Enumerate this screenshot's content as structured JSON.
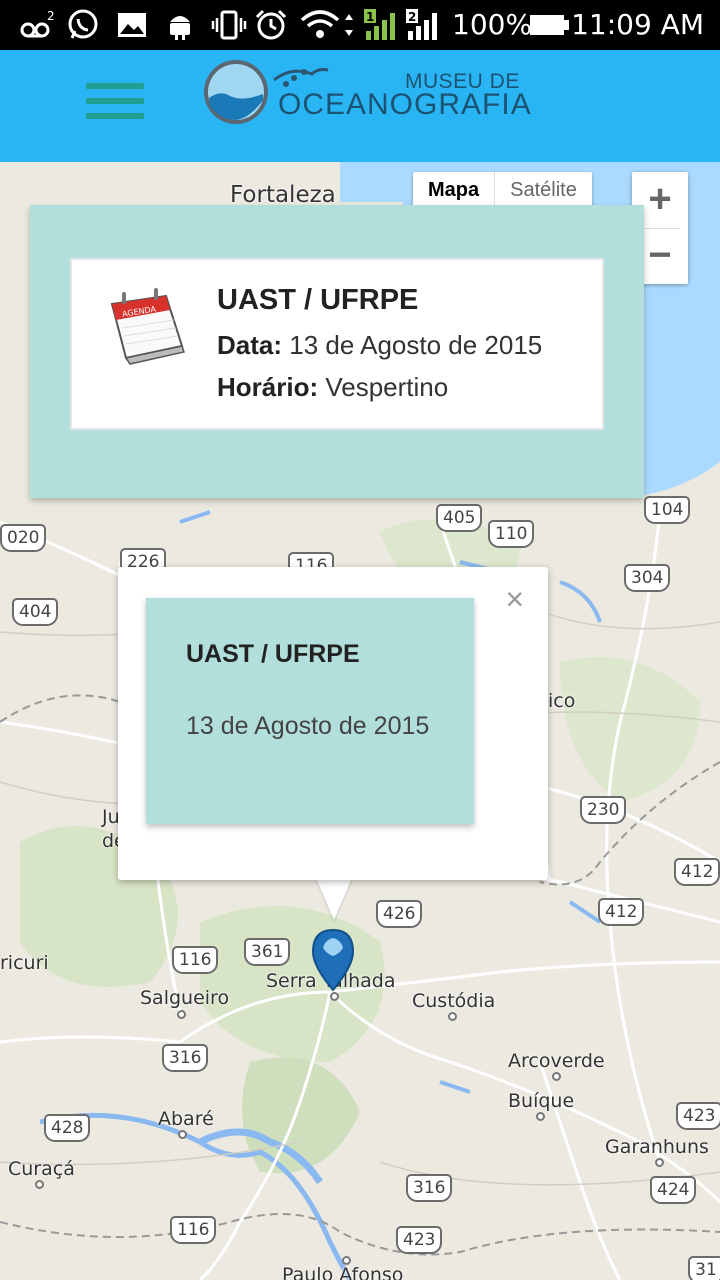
{
  "status_bar": {
    "battery_percent": "100%",
    "time": "11:09 AM",
    "sim1_label": "1",
    "sim2_label": "2",
    "voicemail_label": "2",
    "icons": [
      "voicemail-icon",
      "whatsapp-icon",
      "gallery-icon",
      "android-icon",
      "vibrate-icon",
      "alarm-icon",
      "wifi-icon",
      "signal-sim1-icon",
      "signal-sim2-icon",
      "battery-icon"
    ]
  },
  "header": {
    "logo_line1": "MUSEU DE",
    "logo_line2": "OCEANOGRAFIA",
    "menu_icon": "hamburger-menu-icon",
    "colors": {
      "appbar": "#29b5f4",
      "hamburger": "#1f9e92",
      "card": "#b2dfdb"
    }
  },
  "map": {
    "map_type": {
      "map": "Mapa",
      "satellite": "Satélite"
    },
    "zoom": {
      "in": "+",
      "out": "−"
    },
    "cities": [
      {
        "name": "Fortaleza"
      },
      {
        "name": "Salgueiro"
      },
      {
        "name": "Serra Talhada"
      },
      {
        "name": "Custódia"
      },
      {
        "name": "Arcoverde"
      },
      {
        "name": "Buíque"
      },
      {
        "name": "Garanhuns"
      },
      {
        "name": "Abaré"
      },
      {
        "name": "Curaçá"
      },
      {
        "name": "Paulo Afonso"
      },
      {
        "name": "ricuri"
      },
      {
        "name": "ico"
      },
      {
        "name": "Ju"
      },
      {
        "name": "de"
      }
    ],
    "roads": [
      "020",
      "226",
      "116",
      "405",
      "110",
      "104",
      "404",
      "304",
      "230",
      "412",
      "412",
      "426",
      "361",
      "116",
      "316",
      "428",
      "316",
      "423",
      "116",
      "423",
      "424",
      "31"
    ]
  },
  "info_card": {
    "title": "UAST / UFRPE",
    "date_label": "Data:",
    "date_value": "13 de Agosto de 2015",
    "time_label": "Horário:",
    "time_value": "Vespertino",
    "calendar_text": "AGENDA"
  },
  "popup": {
    "close": "×",
    "title": "UAST / UFRPE",
    "date": "13 de Agosto de 2015"
  }
}
